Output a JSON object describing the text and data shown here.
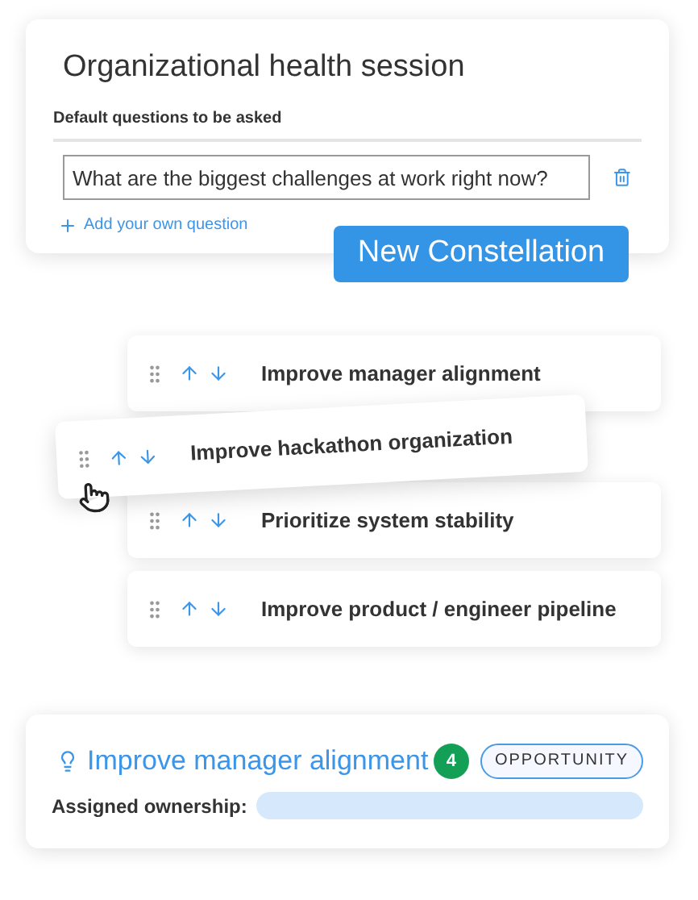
{
  "session": {
    "title": "Organizational health session",
    "section_label": "Default questions to be asked",
    "question": "What are the biggest challenges at work right now?",
    "add_label": "Add your own question"
  },
  "new_button": "New Constellation",
  "items": [
    {
      "label": "Improve manager alignment",
      "dragging": false
    },
    {
      "label": "Improve hackathon organization",
      "dragging": true
    },
    {
      "label": "Prioritize system stability",
      "dragging": false
    },
    {
      "label": "Improve product / engineer pipeline",
      "dragging": false
    }
  ],
  "result": {
    "title": "Improve manager alignment",
    "score": "4",
    "tag": "OPPORTUNITY",
    "ownership_label": "Assigned ownership:"
  }
}
